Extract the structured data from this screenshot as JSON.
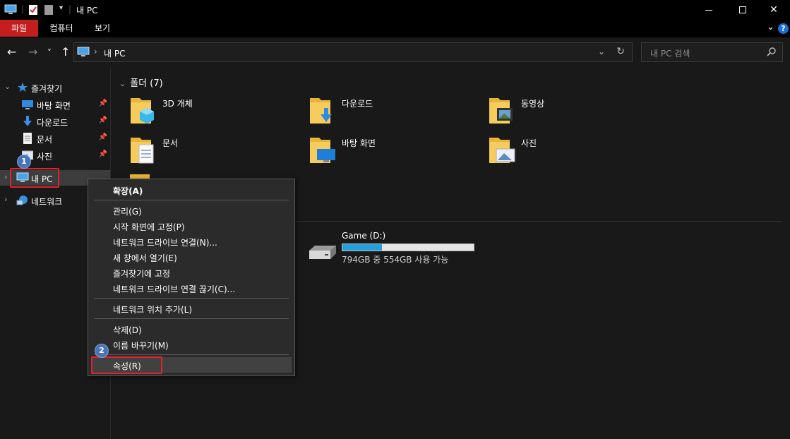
{
  "window": {
    "title": "내 PC",
    "minimize": "—",
    "maximize": "☐",
    "close": "✕"
  },
  "ribbon": {
    "tabs": [
      {
        "label": "파일",
        "active": true
      },
      {
        "label": "컴퓨터",
        "active": false
      },
      {
        "label": "보기",
        "active": false
      }
    ],
    "help": "?"
  },
  "nav": {
    "back": "←",
    "forward": "→",
    "recent": "˅",
    "up": "↑",
    "address": "내 PC",
    "breadcrumb_sep": "›",
    "search_placeholder": "내 PC 검색"
  },
  "sidebar": {
    "items": [
      {
        "label": "즐겨찾기",
        "icon": "star-icon"
      },
      {
        "label": "바탕 화면",
        "icon": "desktop-icon",
        "pinned": true
      },
      {
        "label": "다운로드",
        "icon": "download-icon",
        "pinned": true
      },
      {
        "label": "문서",
        "icon": "document-icon",
        "pinned": true
      },
      {
        "label": "사진",
        "icon": "pictures-icon",
        "pinned": true
      },
      {
        "label": "내 PC",
        "icon": "computer-icon",
        "selected": true
      },
      {
        "label": "네트워크",
        "icon": "network-icon"
      }
    ]
  },
  "main": {
    "folders_header": "폴더 (7)",
    "folders": [
      {
        "label": "3D 개체",
        "overlay": "cube"
      },
      {
        "label": "다운로드",
        "overlay": "download"
      },
      {
        "label": "동영상",
        "overlay": "video"
      },
      {
        "label": "문서",
        "overlay": "document"
      },
      {
        "label": "바탕 화면",
        "overlay": "desktop"
      },
      {
        "label": "사진",
        "overlay": "picture"
      }
    ],
    "drive": {
      "label": "Game (D:)",
      "space": "794GB 중 554GB 사용 가능",
      "used_fraction": 0.3
    }
  },
  "context_menu": {
    "items": [
      {
        "label": "확장(A)",
        "bold": true
      },
      {
        "label": "관리(G)"
      },
      {
        "label": "시작 화면에 고정(P)"
      },
      {
        "label": "네트워크 드라이브 연결(N)..."
      },
      {
        "label": "새 창에서 열기(E)"
      },
      {
        "label": "즐겨찾기에 고정"
      },
      {
        "label": "네트워크 드라이브 연결 끊기(C)..."
      },
      {
        "label": "네트워크 위치 추가(L)"
      },
      {
        "label": "삭제(D)"
      },
      {
        "label": "이름 바꾸기(M)"
      },
      {
        "label": "속성(R)",
        "hover": true
      }
    ]
  },
  "annotations": {
    "badge1": "1",
    "badge2": "2",
    "mark_color": "#e0242c",
    "badge_color": "#4a74b8"
  },
  "colors": {
    "accent_file_tab": "#c41e1e",
    "drive_bar": "#26a0da",
    "folder_yellow": "#f2c14e"
  }
}
